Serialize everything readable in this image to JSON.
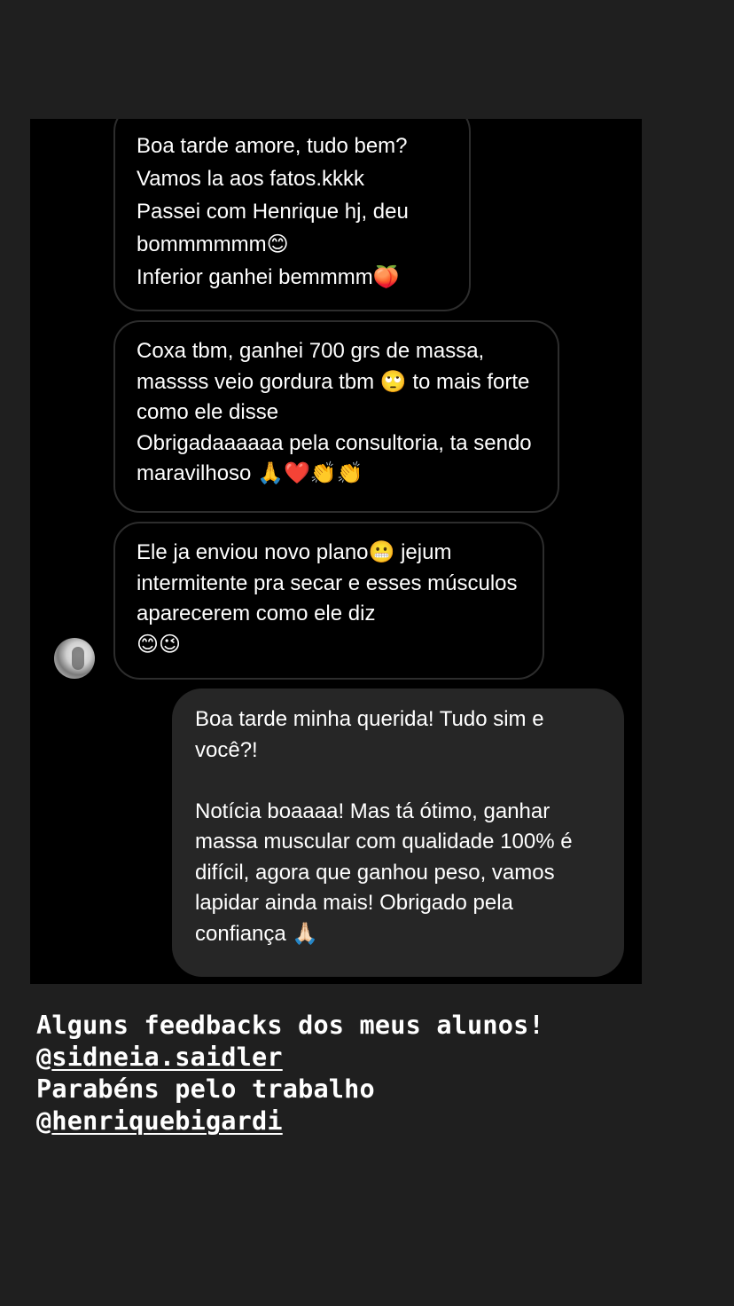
{
  "messages": {
    "m1": "Boa tarde amore, tudo bem?\nVamos la aos fatos.kkkk\nPassei com Henrique hj, deu bommmmmm😊\nInferior ganhei bemmmm🍑",
    "m2": "Coxa tbm, ganhei 700 grs de massa, massss veio gordura tbm 🙄 to mais forte como ele disse\nObrigadaaaaaa pela consultoria, ta sendo maravilhoso 🙏❤️👏👏",
    "m3": "Ele ja enviou novo plano😬 jejum intermitente pra secar e esses músculos aparecerem como ele diz\n😊😉",
    "m4": "Boa tarde minha querida! Tudo sim e você?!\n\nNotícia boaaaa! Mas tá ótimo, ganhar massa muscular com qualidade 100% é difícil, agora que ganhou peso, vamos lapidar ainda mais! Obrigado pela confiança 🙏🏻"
  },
  "caption": {
    "line1": "Alguns feedbacks dos meus alunos!",
    "line2_prefix": "@",
    "mention1": "sidneia.saidler",
    "line3": "Parabéns pelo trabalho",
    "line4_prefix": "@",
    "mention2": "henriquebigardi"
  },
  "colors": {
    "background": "#1f1f1f",
    "chat_background": "#000000",
    "incoming_border": "#2d2d2d",
    "outgoing_bubble": "#262626",
    "text": "#ffffff"
  },
  "icons": {
    "avatar": "user-avatar-photo"
  }
}
